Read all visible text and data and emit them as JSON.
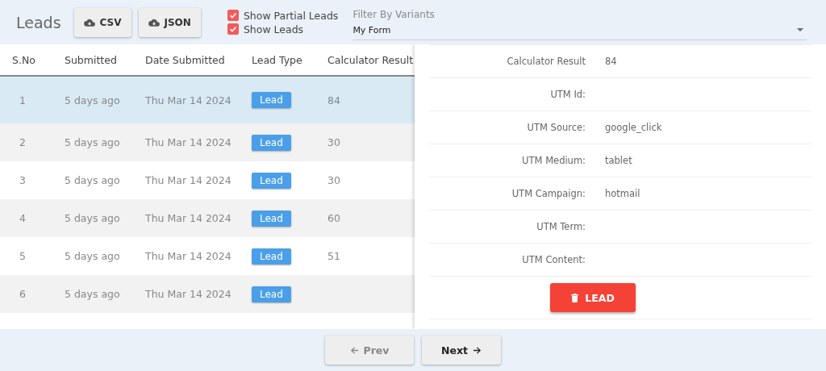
{
  "header": {
    "title": "Leads",
    "buttons": [
      {
        "label": "CSV"
      },
      {
        "label": "JSON"
      }
    ],
    "checkboxes": [
      {
        "label": "Show Partial Leads",
        "checked": true
      },
      {
        "label": "Show Leads",
        "checked": true
      }
    ],
    "filter": {
      "label": "Filter By Variants",
      "value": "My Form"
    }
  },
  "table": {
    "columns": [
      "S.No",
      "Submitted",
      "Date Submitted",
      "Lead Type",
      "Calculator Result"
    ],
    "rows": [
      {
        "sno": "1",
        "submitted": "5 days ago",
        "date": "Thu Mar 14 2024",
        "lead_type": "Lead",
        "result": "84",
        "selected": true
      },
      {
        "sno": "2",
        "submitted": "5 days ago",
        "date": "Thu Mar 14 2024",
        "lead_type": "Lead",
        "result": "30",
        "selected": false
      },
      {
        "sno": "3",
        "submitted": "5 days ago",
        "date": "Thu Mar 14 2024",
        "lead_type": "Lead",
        "result": "30",
        "selected": false
      },
      {
        "sno": "4",
        "submitted": "5 days ago",
        "date": "Thu Mar 14 2024",
        "lead_type": "Lead",
        "result": "60",
        "selected": false
      },
      {
        "sno": "5",
        "submitted": "5 days ago",
        "date": "Thu Mar 14 2024",
        "lead_type": "Lead",
        "result": "51",
        "selected": false
      },
      {
        "sno": "6",
        "submitted": "5 days ago",
        "date": "Thu Mar 14 2024",
        "lead_type": "Lead",
        "selected": false
      }
    ]
  },
  "details": {
    "fields": [
      {
        "label": "Calculator Result",
        "value": "84"
      },
      {
        "label": "UTM Id:"
      },
      {
        "label": "UTM Source:",
        "value": "google_click"
      },
      {
        "label": "UTM Medium:",
        "value": "tablet"
      },
      {
        "label": "UTM Campaign:",
        "value": "hotmail"
      },
      {
        "label": "UTM Term:"
      },
      {
        "label": "UTM Content:"
      }
    ],
    "delete_button": "LEAD"
  },
  "pagination": [
    {
      "label": "Prev",
      "kind": "prev",
      "disabled": true
    },
    {
      "label": "Next",
      "kind": "next",
      "disabled": false
    }
  ]
}
